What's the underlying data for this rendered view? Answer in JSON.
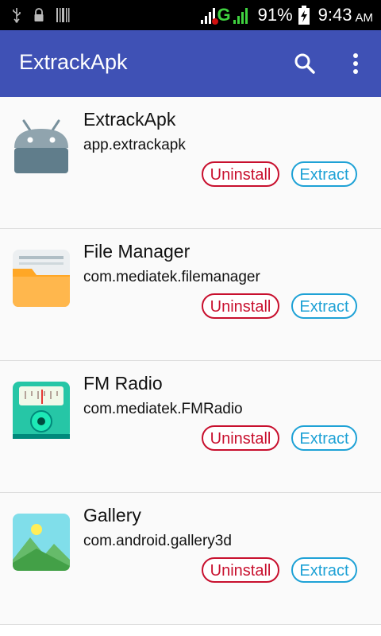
{
  "status_bar": {
    "network": "G",
    "battery": "91%",
    "time": "9:43",
    "ampm": "AM",
    "icons": [
      "usb-icon",
      "lock-icon",
      "barcode-icon",
      "signal-icon",
      "signal-icon",
      "battery-charging-icon"
    ]
  },
  "app_bar": {
    "title": "ExtrackApk",
    "color": "#3f51b5",
    "actions": [
      "search-icon",
      "more-vert-icon"
    ]
  },
  "apps": [
    {
      "name": "ExtrackApk",
      "package": "app.extrackapk",
      "icon": "android-icon"
    },
    {
      "name": "File Manager",
      "package": "com.mediatek.filemanager",
      "icon": "folder-icon"
    },
    {
      "name": "FM Radio",
      "package": "com.mediatek.FMRadio",
      "icon": "radio-icon"
    },
    {
      "name": "Gallery",
      "package": "com.android.gallery3d",
      "icon": "gallery-icon"
    }
  ],
  "buttons": {
    "uninstall_label": "Uninstall",
    "extract_label": "Extract",
    "uninstall_color": "#c8102e",
    "extract_color": "#1fa2d6"
  }
}
